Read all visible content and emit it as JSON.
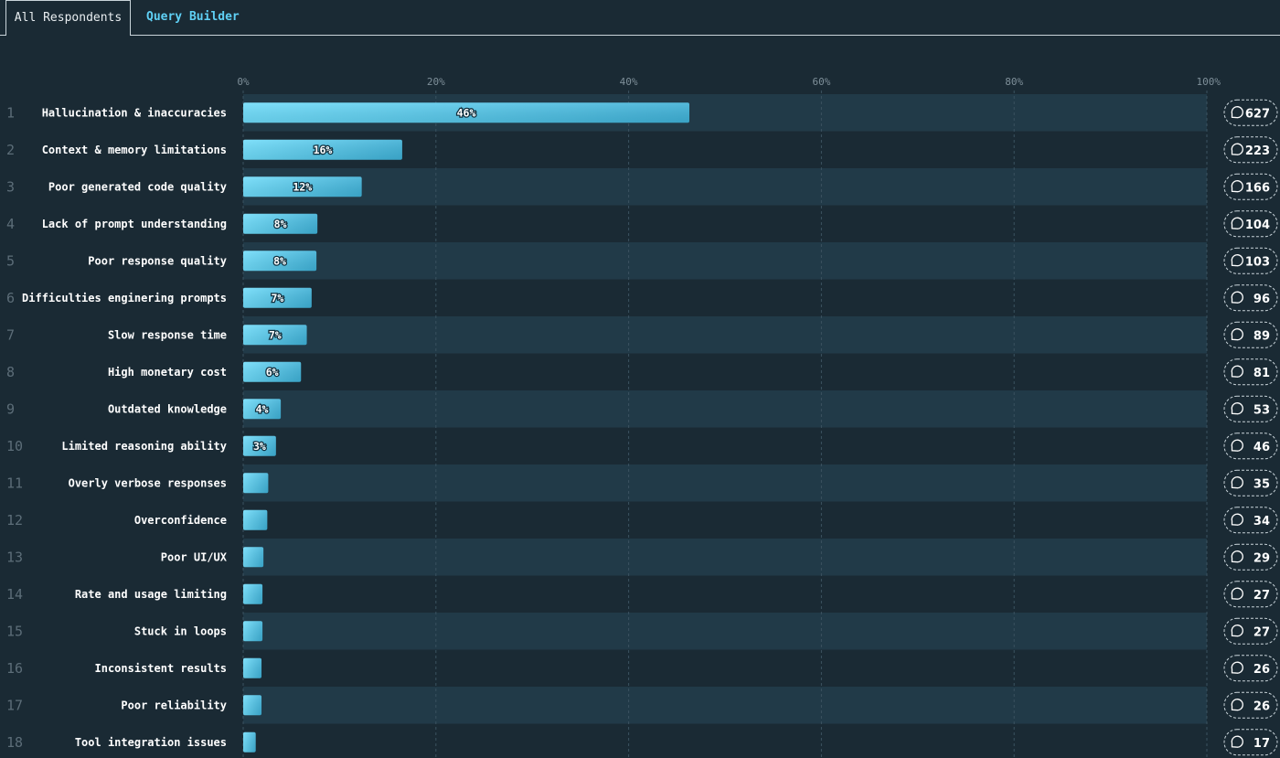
{
  "tabs": [
    {
      "label": "All Respondents",
      "active": true
    },
    {
      "label": "Query Builder",
      "active": false
    }
  ],
  "colors": {
    "background": "#1a2a34",
    "row_alt": "#213a48",
    "bar_light": "#6fdcfa",
    "bar_dark": "#3eb0d6",
    "accent": "#5fd0f5"
  },
  "chart_data": {
    "type": "bar",
    "orientation": "horizontal",
    "xlim": [
      0,
      100
    ],
    "ticks": [
      "0%",
      "20%",
      "40%",
      "60%",
      "80%",
      "100%"
    ],
    "tick_values": [
      0,
      20,
      40,
      60,
      80,
      100
    ],
    "grid": true,
    "ranks": [
      "1",
      "2",
      "3",
      "4",
      "5",
      "6",
      "7",
      "8",
      "9",
      "10",
      "11",
      "12",
      "13",
      "14",
      "15",
      "16",
      "17",
      "18"
    ],
    "categories": [
      "Hallucination & inaccuracies",
      "Context & memory limitations",
      "Poor generated code quality",
      "Lack of prompt understanding",
      "Poor response quality",
      "Difficulties enginering prompts",
      "Slow response time",
      "High monetary cost",
      "Outdated knowledge",
      "Limited reasoning ability",
      "Overly verbose responses",
      "Overconfidence",
      "Poor UI/UX",
      "Rate and usage limiting",
      "Stuck in loops",
      "Inconsistent results",
      "Poor reliability",
      "Tool integration issues"
    ],
    "values": [
      46.3,
      16.5,
      12.3,
      7.7,
      7.6,
      7.1,
      6.6,
      6.0,
      3.9,
      3.4,
      2.6,
      2.5,
      2.1,
      2.0,
      2.0,
      1.9,
      1.9,
      1.3
    ],
    "value_labels": [
      "46%",
      "16%",
      "12%",
      "8%",
      "8%",
      "7%",
      "7%",
      "6%",
      "4%",
      "3%",
      "",
      "",
      "",
      "",
      "",
      "",
      "",
      ""
    ],
    "counts": [
      "627",
      "223",
      "166",
      "104",
      "103",
      "96",
      "89",
      "81",
      "53",
      "46",
      "35",
      "34",
      "29",
      "27",
      "27",
      "26",
      "26",
      "17"
    ]
  }
}
